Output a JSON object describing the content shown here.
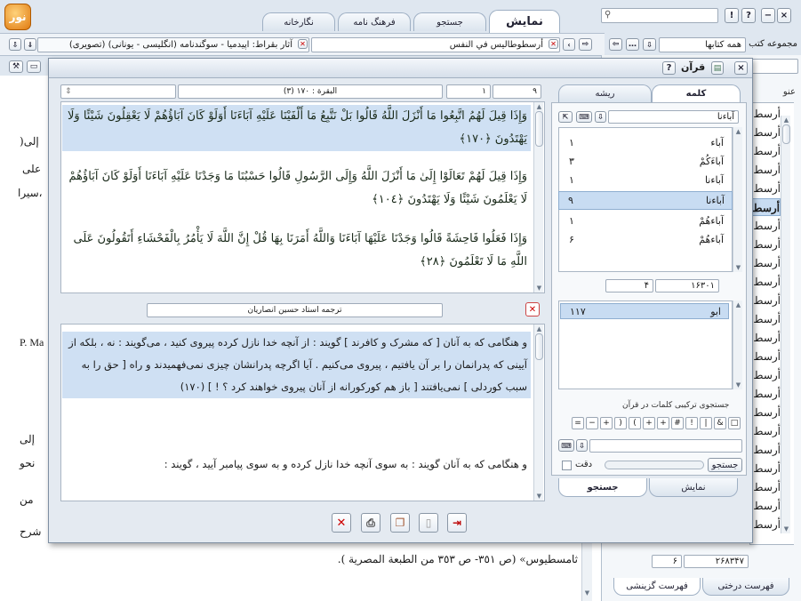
{
  "app": {
    "logo": "نور"
  },
  "window_controls": {
    "search_value": "",
    "help": "!",
    "question": "?",
    "minimize": "−",
    "close": "×"
  },
  "tabs": [
    {
      "label": "نمایش"
    },
    {
      "label": "جستجو"
    },
    {
      "label": "فرهنگ نامه"
    },
    {
      "label": "نگارخانه"
    }
  ],
  "book_tabs": {
    "tab1": "أرسطوطاليس في النفس",
    "tab2": "آثار بقراط: اپیدمیا - سوگندنامه (انگلیسی - یونانی) (تصویری)"
  },
  "collection": {
    "label": "مجموعه کتب",
    "value": "همه کتابها"
  },
  "right_tree": {
    "header": "عنو",
    "items": [
      "أرسط",
      "أرسط",
      "أرسط",
      "أرسط",
      "أرسط",
      "أرسط",
      "أرسط",
      "أرسط",
      "أرسط",
      "أرسط",
      "أرسط",
      "أرسط",
      "أرسط",
      "أرسط",
      "أرسط",
      "أرسط",
      "أرسط",
      "أرسط",
      "أرسط",
      "أرسط",
      "أرسط",
      "أرسط",
      "أرسط"
    ],
    "total": "۲۶۸۳۴۷",
    "count": "۶",
    "tab_tree": "فهرست درختی",
    "tab_select": "فهرست گزینشی"
  },
  "bg_text": {
    "l1": ")إلى",
    "l2": "على",
    "l3": "سيرا،",
    "l4": "P. Ma",
    "l5": "إلى",
    "l6": "نحو",
    "l7": "من",
    "l8": "شرح",
    "l9": "ثامسطيوس» (ص ٣٥١- ص ٣٥٣ من الطبعة المصرية )."
  },
  "dialog": {
    "title": "قرآن",
    "ayah_nav": {
      "number": "۹",
      "ayah": "۱",
      "surah": "(۳) البقرة : ۱۷۰"
    },
    "verses": [
      {
        "text": "وَإِذَا قِيلَ لَهُمُ اتَّبِعُوا مَا أَنْزَلَ اللَّهُ قَالُوا بَلْ نَتَّبِعُ مَا أَلْفَيْنَا عَلَيْهِ آبَاءَنَا أَوَلَوْ كَانَ آبَاؤُهُمْ لَا يَعْقِلُونَ شَيْئًا وَلَا يَهْتَدُونَ ﴿١٧٠﴾",
        "highlight": "آبَاءَنَا"
      },
      {
        "text": "وَإِذَا قِيلَ لَهُمْ تَعَالَوْا إِلَىٰ مَا أَنْزَلَ اللَّهُ وَإِلَى الرَّسُولِ قَالُوا حَسْبُنَا مَا وَجَدْنَا عَلَيْهِ آبَاءَنَا أَوَلَوْ كَانَ آبَاؤُهُمْ لَا يَعْلَمُونَ شَيْئًا وَلَا يَهْتَدُونَ ﴿١٠٤﴾"
      },
      {
        "text": "وَإِذَا فَعَلُوا فَاحِشَةً قَالُوا وَجَدْنَا عَلَيْهَا آبَاءَنَا وَاللَّهُ أَمَرَنَا بِهَا قُلْ إِنَّ اللَّهَ لَا يَأْمُرُ بِالْفَحْشَاءِ أَتَقُولُونَ عَلَى اللَّهِ مَا لَا تَعْلَمُونَ ﴿٢٨﴾"
      }
    ],
    "translator": "ترجمه استاد حسین انصاریان",
    "translation": {
      "p1": "و هنگامی که به آنان [ که مشرک و کافرند ] گویند : از آنچه خدا نازل کرده پیروی کنید ، می‌گویند : نه ، بلکه از آیینی که پدرانمان را بر آن یافتیم ، پیروی می‌کنیم . آیا اگرچه پدرانشان چیزی نمی‌فهمیدند و راه [ حق را به سبب کوردلی ] نمی‌یافتند [ باز هم کورکورانه از آنان پیروی خواهند کرد ؟ ! ] (۱۷۰)",
      "p2": "و هنگامی که به آنان گویند : به سوی آنچه خدا نازل کرده و به سوی پیامبر آیید ، گویند :"
    },
    "side": {
      "tab_word": "کلمه",
      "tab_root": "ریشه",
      "word_input": "آباءنا",
      "words": [
        {
          "w": "آباء",
          "n": "۱"
        },
        {
          "w": "آباءَكُمْ",
          "n": "۳"
        },
        {
          "w": "آباءنا",
          "n": "۱"
        },
        {
          "w": "آباءنا",
          "n": "۹"
        },
        {
          "w": "آباءهُمْ",
          "n": "۱"
        },
        {
          "w": "آباءهُمْ",
          "n": "۶"
        }
      ],
      "counter_left": "۴",
      "counter_right": "۱۶۳۰۱",
      "roots": [
        {
          "w": "ابو",
          "n": "۱۱۷"
        }
      ],
      "combo_label": "جستجوی ترکیبی کلمات در قرآن",
      "keys": [
        "□",
        "&",
        "|",
        "!",
        "#",
        "+",
        "+",
        "(",
        ")",
        "+",
        "−",
        "="
      ],
      "search_button": "جستجو",
      "exact_label": "دقت",
      "tab_display": "نمایش",
      "tab_search": "جستجو"
    },
    "footer": {
      "close": "close",
      "print": "print",
      "copy": "copy",
      "blank": "blank",
      "exit": "exit"
    }
  }
}
